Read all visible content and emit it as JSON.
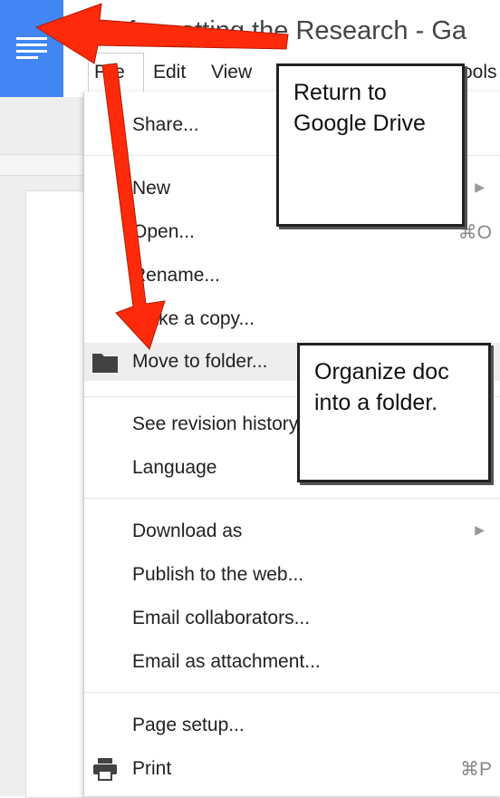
{
  "app": {
    "title": "Reformatting the Research - Ga"
  },
  "menubar": {
    "file": "File",
    "edit": "Edit",
    "view": "View",
    "tools": "ools"
  },
  "file_menu": {
    "share": "Share...",
    "new": "New",
    "open": "Open...",
    "open_shortcut": "⌘O",
    "rename": "Rename...",
    "make_copy": "Make a copy...",
    "move_to_folder": "Move to folder...",
    "see_revision_history": "See revision history",
    "language": "Language",
    "download_as": "Download as",
    "publish_to_web": "Publish to the web...",
    "email_collaborators": "Email collaborators...",
    "email_as_attachment": "Email as attachment...",
    "page_setup": "Page setup...",
    "print": "Print",
    "print_shortcut": "⌘P"
  },
  "annotations": {
    "drive_callout": "Return to Google Drive",
    "folder_callout": "Organize doc into a folder."
  },
  "icons": [
    "docs-menu-icon",
    "folder-icon",
    "printer-icon",
    "submenu-arrow-icon"
  ],
  "colors": {
    "docs_blue": "#4285f4",
    "arrow_red": "#ff2a0a",
    "highlight": "#eeeeee"
  }
}
